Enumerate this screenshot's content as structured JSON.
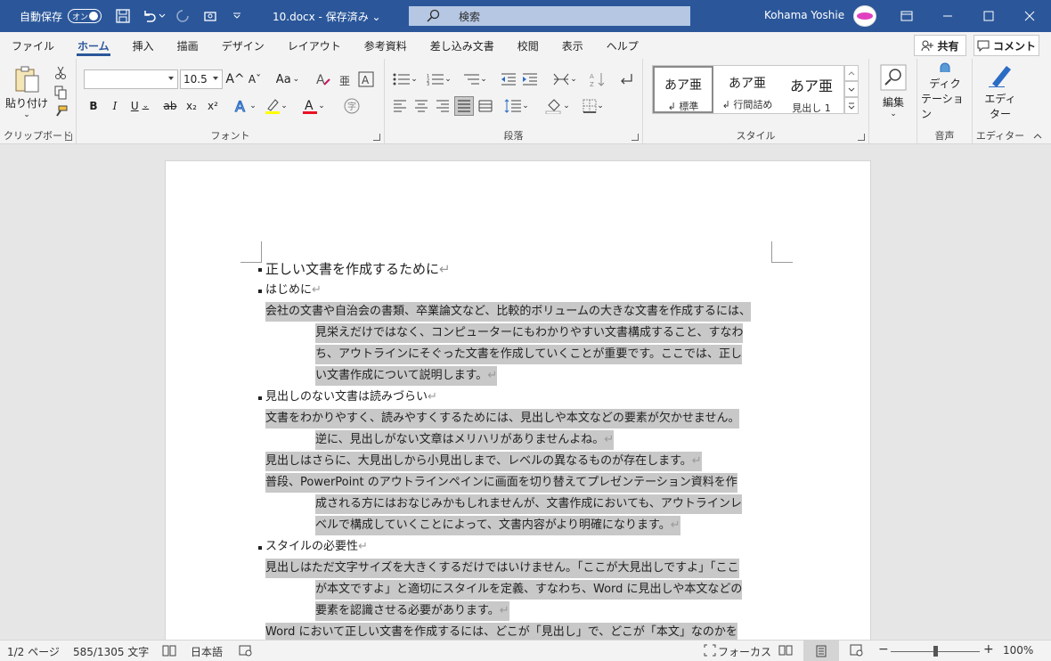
{
  "titlebar": {
    "autosave_label": "自動保存",
    "autosave_state": "オン",
    "doc_name": "10.docx - 保存済み ⌄",
    "search_label": "検索",
    "user_name": "Kohama Yoshie"
  },
  "tabs": [
    "ファイル",
    "ホーム",
    "挿入",
    "描画",
    "デザイン",
    "レイアウト",
    "参考資料",
    "差し込み文書",
    "校閲",
    "表示",
    "ヘルプ"
  ],
  "active_tab": "ホーム",
  "share_label": "共有",
  "comment_label": "コメント",
  "ribbon": {
    "clipboard": {
      "paste_label": "貼り付け",
      "group_label": "クリップボード"
    },
    "font": {
      "font_name": "",
      "font_size": "10.5",
      "group_label": "フォント",
      "b": "B",
      "i": "I",
      "u": "U",
      "strike": "ab",
      "sub": "x₂",
      "sup": "x²",
      "case": "Aa",
      "char_border": "A",
      "grow": "A^",
      "shrink": "Aˇ"
    },
    "paragraph": {
      "group_label": "段落"
    },
    "styles": {
      "group_label": "スタイル",
      "items": [
        {
          "sample": "あア亜",
          "name": "↲ 標準"
        },
        {
          "sample": "あア亜",
          "name": "↲ 行間詰め"
        },
        {
          "sample": "あア亜",
          "name": "見出し 1"
        }
      ]
    },
    "editing": {
      "label": "編集"
    },
    "voice": {
      "label_line1": "ディク",
      "label_line2": "テーション",
      "group_label": "音声"
    },
    "editor": {
      "label_line1": "エディ",
      "label_line2": "ター",
      "group_label": "エディター"
    }
  },
  "document": {
    "lines": [
      {
        "text": "正しい文書を作成するために",
        "mark": "↵",
        "bullet": true,
        "hl": false,
        "head": true
      },
      {
        "text": "はじめに",
        "mark": "↵",
        "bullet": true,
        "hl": false
      },
      {
        "text": "会社の文書や自治会の書類、卒業論文など、比較的ボリュームの大きな文書を作成するには、",
        "mark": "",
        "bullet": false,
        "hl": true,
        "indent": false
      },
      {
        "text": "見栄えだけではなく、コンピューターにもわかりやすい文書構成すること、すなわ",
        "mark": "",
        "bullet": false,
        "hl": true,
        "indent": true
      },
      {
        "text": "ち、アウトラインにそぐった文書を作成していくことが重要です。ここでは、正し",
        "mark": "",
        "bullet": false,
        "hl": true,
        "indent": true
      },
      {
        "text": "い文書作成について説明します。",
        "mark": "↵",
        "bullet": false,
        "hl": true,
        "indent": true
      },
      {
        "text": "見出しのない文書は読みづらい",
        "mark": "↵",
        "bullet": true,
        "hl": false
      },
      {
        "text": "文書をわかりやすく、読みやすくするためには、見出しや本文などの要素が欠かせません。",
        "mark": "",
        "bullet": false,
        "hl": true,
        "indent": false
      },
      {
        "text": "逆に、見出しがない文章はメリハリがありませんよね。",
        "mark": "↵",
        "bullet": false,
        "hl": true,
        "indent": true
      },
      {
        "text": "見出しはさらに、大見出しから小見出しまで、レベルの異なるものが存在します。",
        "mark": "↵",
        "bullet": false,
        "hl": true,
        "indent": false
      },
      {
        "text": "普段、PowerPoint のアウトラインペインに画面を切り替えてプレゼンテーション資料を作",
        "mark": "",
        "bullet": false,
        "hl": true,
        "indent": false
      },
      {
        "text": "成される方にはおなじみかもしれませんが、文書作成においても、アウトラインレ",
        "mark": "",
        "bullet": false,
        "hl": true,
        "indent": true
      },
      {
        "text": "ベルで構成していくことによって、文書内容がより明確になります。",
        "mark": "↵",
        "bullet": false,
        "hl": true,
        "indent": true
      },
      {
        "text": "スタイルの必要性",
        "mark": "↵",
        "bullet": true,
        "hl": false
      },
      {
        "text": "見出しはただ文字サイズを大きくするだけではいけません。「ここが大見出しですよ」「ここ",
        "mark": "",
        "bullet": false,
        "hl": true,
        "indent": false
      },
      {
        "text": "が本文ですよ」と適切にスタイルを定義、すなわち、Word に見出しや本文などの",
        "mark": "",
        "bullet": false,
        "hl": true,
        "indent": true
      },
      {
        "text": "要素を認識させる必要があります。",
        "mark": "↵",
        "bullet": false,
        "hl": true,
        "indent": true
      },
      {
        "text": "Word において正しい文書を作成するには、どこが「見出し」で、どこが「本文」なのかを",
        "mark": "",
        "bullet": false,
        "hl": true,
        "indent": false
      }
    ]
  },
  "statusbar": {
    "page": "1/2 ページ",
    "words": "585/1305 文字",
    "language": "日本語",
    "focus": "フォーカス",
    "zoom": "100%",
    "minus": "−",
    "plus": "+"
  }
}
